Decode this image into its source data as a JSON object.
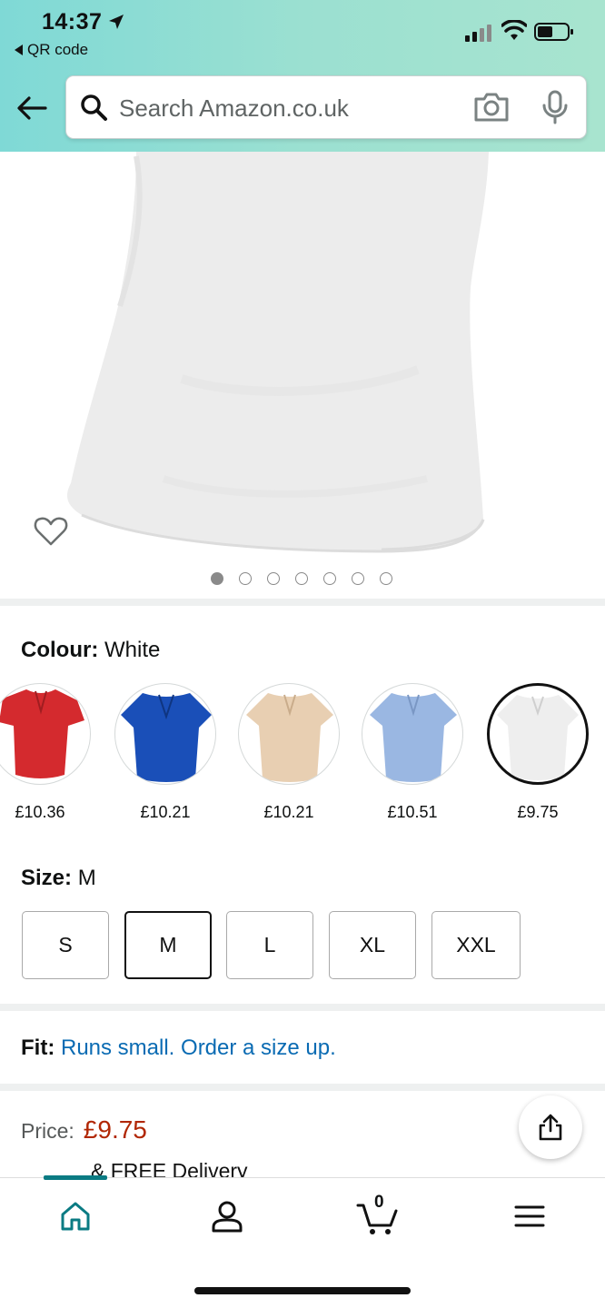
{
  "status_bar": {
    "time": "14:37",
    "back_app": "QR code"
  },
  "search": {
    "placeholder": "Search Amazon.co.uk"
  },
  "carousel": {
    "total_images": 7,
    "active_index": 0
  },
  "colour": {
    "label": "Colour:",
    "selected": "White",
    "options": [
      {
        "name": "Red",
        "price": "£10.36",
        "color": "#d42a2e"
      },
      {
        "name": "Blue",
        "price": "£10.21",
        "color": "#1a4fb8"
      },
      {
        "name": "Beige",
        "price": "£10.21",
        "color": "#e8cfb2"
      },
      {
        "name": "Light Blue",
        "price": "£10.51",
        "color": "#9ab7e2"
      },
      {
        "name": "White",
        "price": "£9.75",
        "color": "#eeeeee"
      }
    ]
  },
  "size": {
    "label": "Size:",
    "selected": "M",
    "options": [
      "S",
      "M",
      "L",
      "XL",
      "XXL"
    ]
  },
  "fit": {
    "label": "Fit:",
    "text": "Runs small. Order a size up."
  },
  "price": {
    "label": "Price:",
    "value": "£9.75",
    "delivery": "& FREE Delivery"
  },
  "cart": {
    "count": "0"
  },
  "colors": {
    "price_red": "#b12704",
    "link_blue": "#0a6bb3",
    "nav_teal": "#0a7b83"
  }
}
